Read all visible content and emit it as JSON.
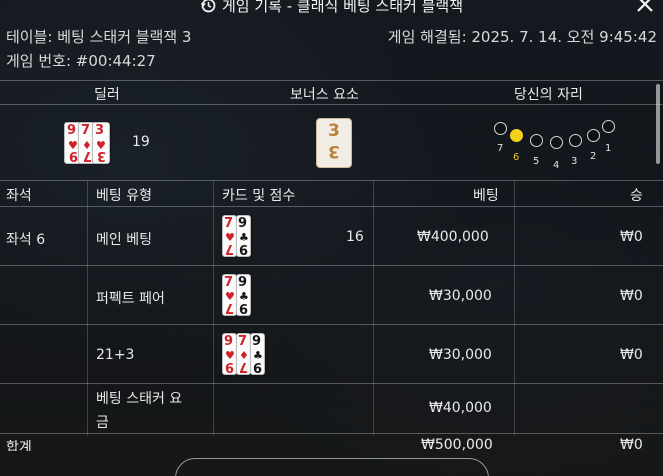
{
  "header": {
    "title": "게임 기록 - 클래식 베팅 스태커 블랙잭"
  },
  "info": {
    "table_label": "테이블: 베팅 스태커 블랙잭 3",
    "settled_label": "게임 해결됨: 2025. 7. 14. 오전 9:45:42",
    "game_number_label": "게임 번호: #00:44:27"
  },
  "summary": {
    "dealer_label": "딜러",
    "bonus_label": "보너스 요소",
    "seat_label": "당신의 자리",
    "dealer_cards": [
      {
        "rank": "9",
        "suit": "♥",
        "color": "red"
      },
      {
        "rank": "7",
        "suit": "♦",
        "color": "red"
      },
      {
        "rank": "3",
        "suit": "♥",
        "color": "red"
      }
    ],
    "dealer_score": "19",
    "bonus_value": "3",
    "seats": [
      "7",
      "6",
      "5",
      "4",
      "3",
      "2",
      "1"
    ],
    "active_seat": "6"
  },
  "table": {
    "headers": {
      "seat": "좌석",
      "bet_type": "베팅 유형",
      "cards_score": "카드 및 점수",
      "bet": "베팅",
      "win": "승"
    },
    "rows": [
      {
        "seat": "좌석 6",
        "bet_type": "메인 베팅",
        "cards": [
          {
            "rank": "7",
            "suit": "♥",
            "color": "red"
          },
          {
            "rank": "9",
            "suit": "♣",
            "color": "black"
          }
        ],
        "score": "16",
        "bet": "₩400,000",
        "win": "₩0"
      },
      {
        "seat": "",
        "bet_type": "퍼펙트 페어",
        "cards": [
          {
            "rank": "7",
            "suit": "♥",
            "color": "red"
          },
          {
            "rank": "9",
            "suit": "♣",
            "color": "black"
          }
        ],
        "score": "",
        "bet": "₩30,000",
        "win": "₩0"
      },
      {
        "seat": "",
        "bet_type": "21+3",
        "cards": [
          {
            "rank": "9",
            "suit": "♥",
            "color": "red"
          },
          {
            "rank": "7",
            "suit": "♦",
            "color": "red"
          },
          {
            "rank": "9",
            "suit": "♣",
            "color": "black"
          }
        ],
        "score": "",
        "bet": "₩30,000",
        "win": "₩0"
      },
      {
        "seat": "",
        "bet_type_line1": "베팅 스태커 요",
        "bet_type_line2": "금",
        "cards": [],
        "score": "",
        "bet": "₩40,000",
        "win": ""
      }
    ],
    "total": {
      "label": "합계",
      "bet": "₩500,000",
      "win": "₩0"
    }
  },
  "colors": {
    "accent": "#f3d21a",
    "card_red": "#d0202a",
    "bonus_gold": "#b9843a"
  }
}
